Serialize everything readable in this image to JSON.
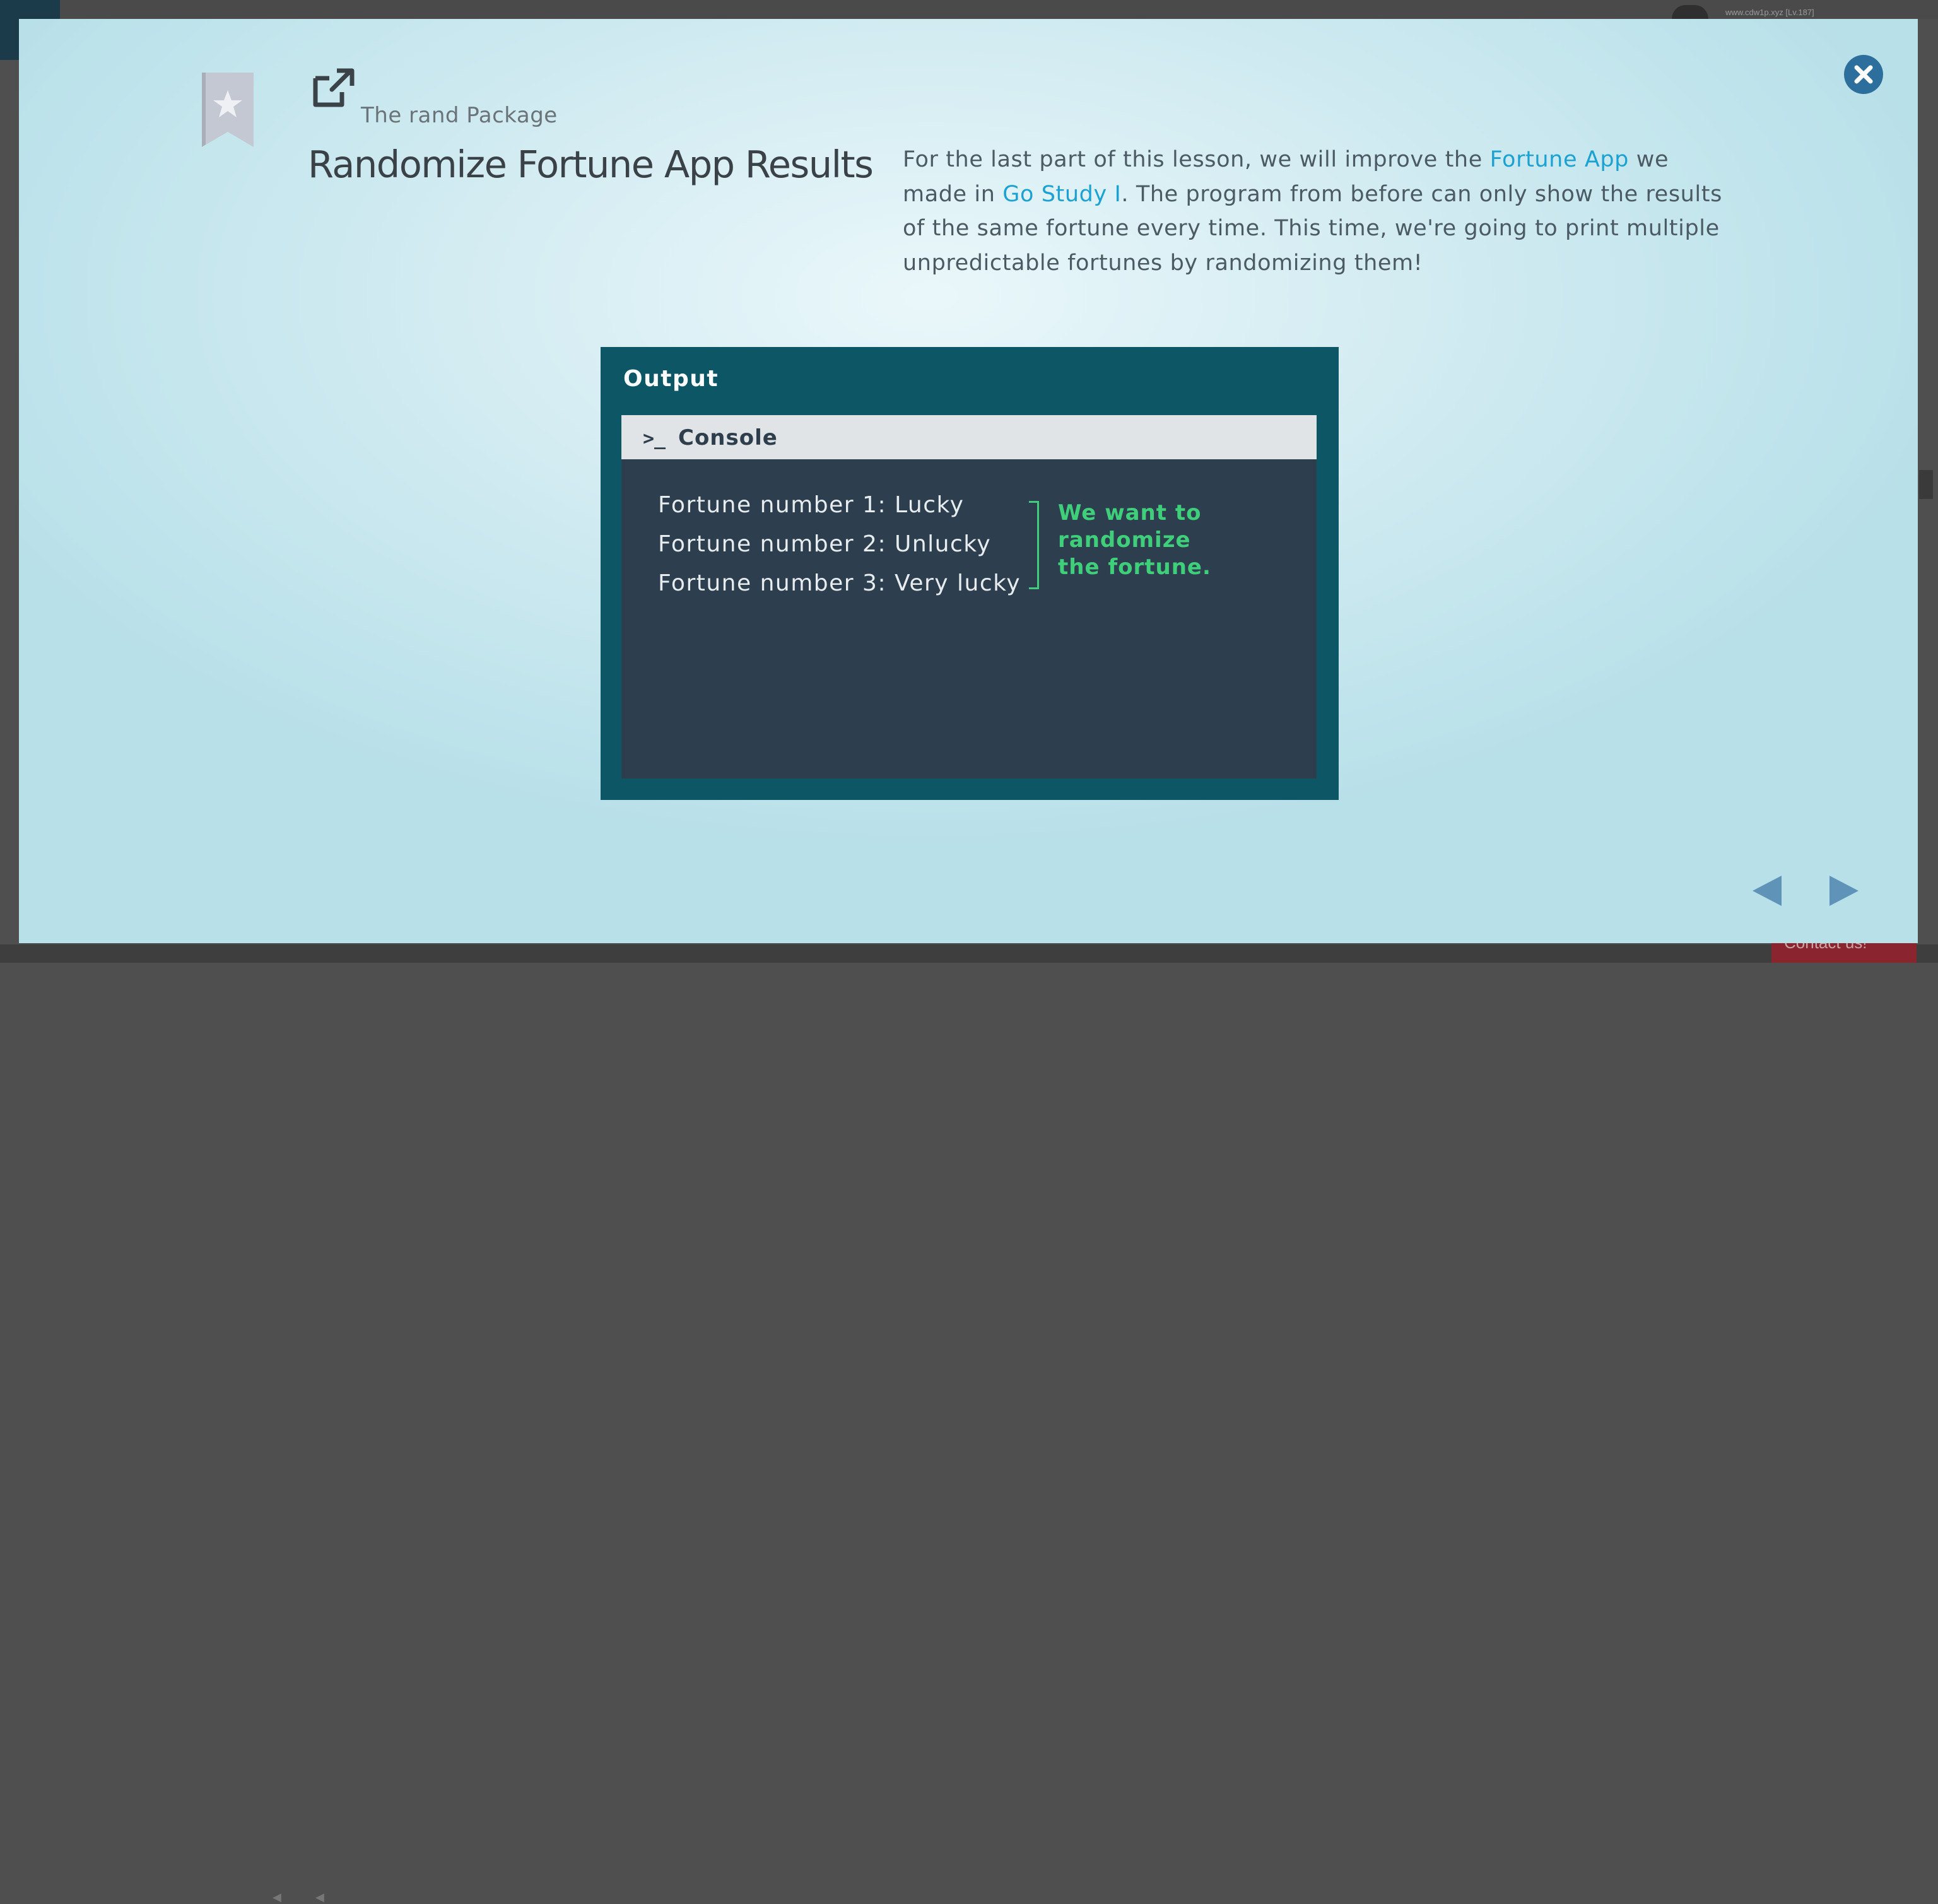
{
  "background": {
    "url_text": "www.cdw1p.xyz [Lv.187]",
    "contact_label": "Contact us!",
    "colors": {
      "contact": "#8a2530"
    }
  },
  "modal": {
    "subtitle": "The rand Package",
    "title": "Randomize Fortune App Results",
    "description": {
      "part1": "For the last part of this lesson, we will improve the ",
      "link1": "Fortune App",
      "part2": " we made in ",
      "link2": "Go Study I",
      "part3": ". The program from before can only show the results of the same fortune every time. This time, we're going to print multiple unpredictable fortunes by randomizing them!"
    },
    "icons": {
      "bookmark": "bookmark-star-icon",
      "external_link": "external-link-icon",
      "close": "close-icon",
      "prev": "prev-arrow-icon",
      "next": "next-arrow-icon"
    },
    "colors": {
      "link": "#1ba1d2",
      "close_button": "#2c6f9c",
      "nav_arrows": "#5f93b8"
    }
  },
  "figure": {
    "output_label": "Output",
    "console_prompt": ">_",
    "console_label": "Console",
    "lines": [
      "Fortune number 1: Lucky",
      "Fortune number 2: Unlucky",
      "Fortune number 3: Very lucky"
    ],
    "annotation": "We want to\nrandomize\nthe fortune.",
    "colors": {
      "frame": "#0c5666",
      "console_bg": "#2d3e4f",
      "annotation": "#3fcf7a"
    }
  }
}
